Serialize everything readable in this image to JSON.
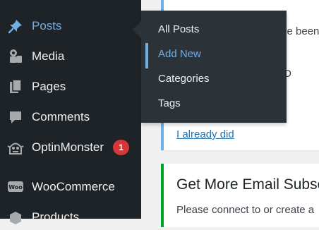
{
  "sidebar": {
    "items": [
      {
        "label": "Posts",
        "icon": "pin-icon"
      },
      {
        "label": "Media",
        "icon": "media-icon"
      },
      {
        "label": "Pages",
        "icon": "pages-icon"
      },
      {
        "label": "Comments",
        "icon": "comments-icon"
      },
      {
        "label": "OptinMonster",
        "icon": "optinmonster-icon",
        "badge": "1"
      },
      {
        "label": "WooCommerce",
        "icon": "woocommerce-icon"
      },
      {
        "label": "Products",
        "icon": "products-icon"
      }
    ]
  },
  "flyout": {
    "items": [
      {
        "label": "All Posts"
      },
      {
        "label": "Add New"
      },
      {
        "label": "Categories"
      },
      {
        "label": "Tags"
      }
    ]
  },
  "notice1": {
    "fragment1": "ve been",
    "fragment2": "D",
    "fragment3": "",
    "link": "I already did"
  },
  "notice2": {
    "title": "Get More Email Subsc",
    "description": "Please connect to or create a"
  },
  "colors": {
    "sidebar_bg": "#1d2327",
    "flyout_bg": "#2c3338",
    "accent": "#72aee6",
    "badge": "#d63638",
    "success_border": "#00a32a"
  }
}
